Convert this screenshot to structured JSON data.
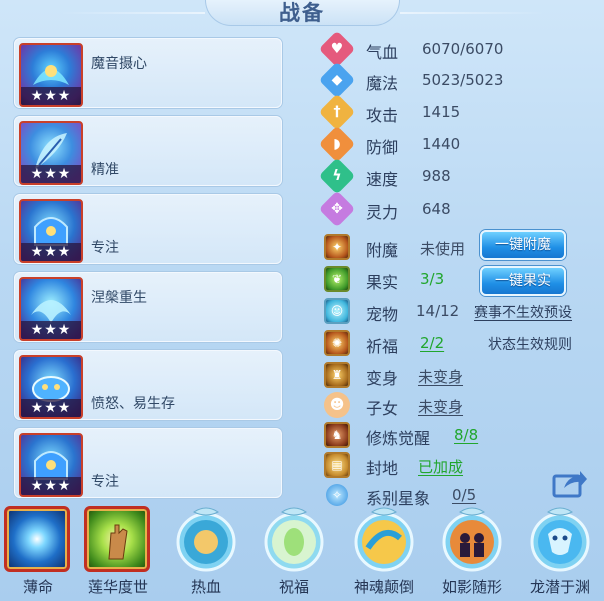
{
  "header": {
    "title": "战备"
  },
  "cards": [
    {
      "label": "魔音摄心",
      "stars": "★★★",
      "icon": "skill-icon-mask"
    },
    {
      "label": "精准",
      "stars": "★★★",
      "icon": "skill-icon-feather"
    },
    {
      "label": "专注",
      "stars": "★★★",
      "icon": "skill-icon-helmet"
    },
    {
      "label": "涅槃重生",
      "stars": "★★★",
      "icon": "skill-icon-phoenix"
    },
    {
      "label": "愤怒、易生存",
      "stars": "★★★",
      "icon": "skill-icon-beast"
    },
    {
      "label": "专注",
      "stars": "★★★",
      "icon": "skill-icon-helmet"
    }
  ],
  "stats": [
    {
      "name": "气血",
      "value": "6070/6070",
      "icon": "heart-icon",
      "color": "#e55a7d"
    },
    {
      "name": "魔法",
      "value": "5023/5023",
      "icon": "mana-icon",
      "color": "#4aa3ef"
    },
    {
      "name": "攻击",
      "value": "1415",
      "icon": "sword-icon",
      "color": "#f0b340"
    },
    {
      "name": "防御",
      "value": "1440",
      "icon": "shield-icon",
      "color": "#f08f3c"
    },
    {
      "name": "速度",
      "value": "988",
      "icon": "lightning-icon",
      "color": "#2fc08a"
    },
    {
      "name": "灵力",
      "value": "648",
      "icon": "spirit-icon",
      "color": "#c57be0"
    }
  ],
  "extras": {
    "enchant": {
      "name": "附魔",
      "value": "未使用",
      "button": "一键附魔"
    },
    "fruit": {
      "name": "果实",
      "value": "3/3",
      "button": "一键果实"
    },
    "pet": {
      "name": "宠物",
      "value": "14/12",
      "link": "赛事不生效预设"
    },
    "blessing": {
      "name": "祈福",
      "value": "2/2",
      "link": "状态生效规则"
    },
    "transform": {
      "name": "变身",
      "value": "未变身"
    },
    "child": {
      "name": "子女",
      "value": "未变身"
    },
    "cultivation": {
      "name": "修炼觉醒",
      "value": "8/8"
    },
    "fief": {
      "name": "封地",
      "value": "已加成"
    },
    "constellation": {
      "name": "系别星象",
      "value": "0/5"
    }
  },
  "skills": [
    {
      "name": "薄命",
      "icon": "orb-icon"
    },
    {
      "name": "莲华度世",
      "icon": "lotus-hand-icon"
    },
    {
      "name": "热血",
      "icon": "warrior-icon"
    },
    {
      "name": "祝福",
      "icon": "blessing-icon"
    },
    {
      "name": "神魂颠倒",
      "icon": "whirl-icon"
    },
    {
      "name": "如影随形",
      "icon": "shadow-icon"
    },
    {
      "name": "龙潜于渊",
      "icon": "dragon-icon"
    }
  ],
  "colors": {
    "accent": "#1f8fe6",
    "green_value": "#21a62d",
    "frame_red": "#c12f22"
  }
}
